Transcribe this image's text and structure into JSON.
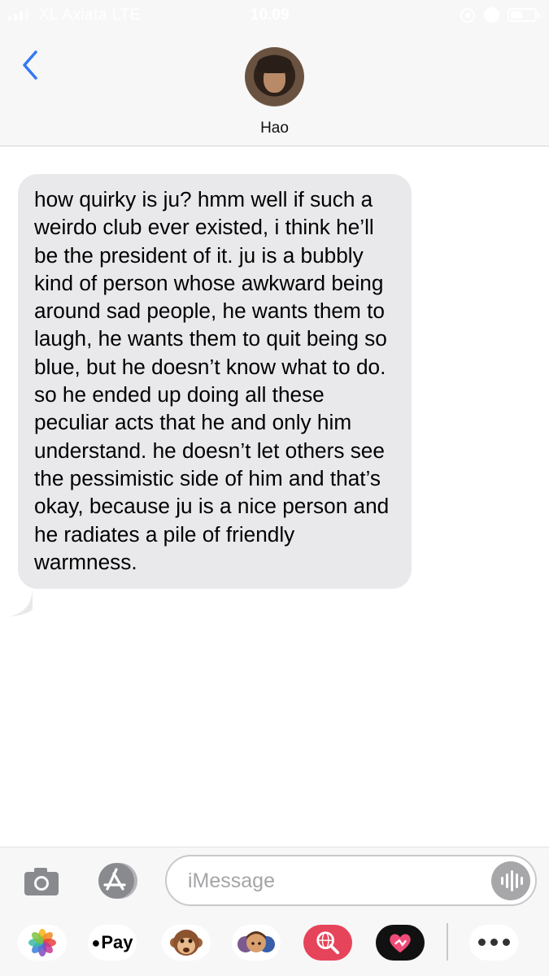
{
  "status_bar": {
    "carrier": "XL Axiata  LTE",
    "time": "10.09"
  },
  "header": {
    "contact_name": "Hao",
    "icons": {
      "back": "chevron-left-icon",
      "avatar": "contact-avatar"
    }
  },
  "conversation": {
    "messages": [
      {
        "direction": "incoming",
        "text": "how quirky is ju? hmm well if such a weirdo club ever existed, i think he’ll be the president of it. ju is a bubbly kind of person whose awkward being around sad people, he wants them to laugh, he wants them to quit being so blue, but he doesn’t know what to do. so he ended up doing all these peculiar acts that he and only him understand. he doesn’t let others see the pessimistic side of him and that’s okay, because ju is a nice person and he radiates a pile of friendly warmness."
      }
    ]
  },
  "input_bar": {
    "placeholder": "iMessage",
    "icons": [
      "camera-icon",
      "app-store-icon",
      "audio-waveform-icon"
    ]
  },
  "app_drawer": {
    "apple_pay_label": "Pay",
    "icons": [
      "photos-icon",
      "apple-pay-icon",
      "monkey-animoji-icon",
      "memoji-icon",
      "web-search-icon",
      "heart-sticker-icon",
      "more-icon"
    ]
  },
  "colors": {
    "accent_blue": "#3478f6",
    "incoming_bubble": "#e9e9eb",
    "header_background": "#f7f7f7",
    "search_app": "#e6445a"
  }
}
